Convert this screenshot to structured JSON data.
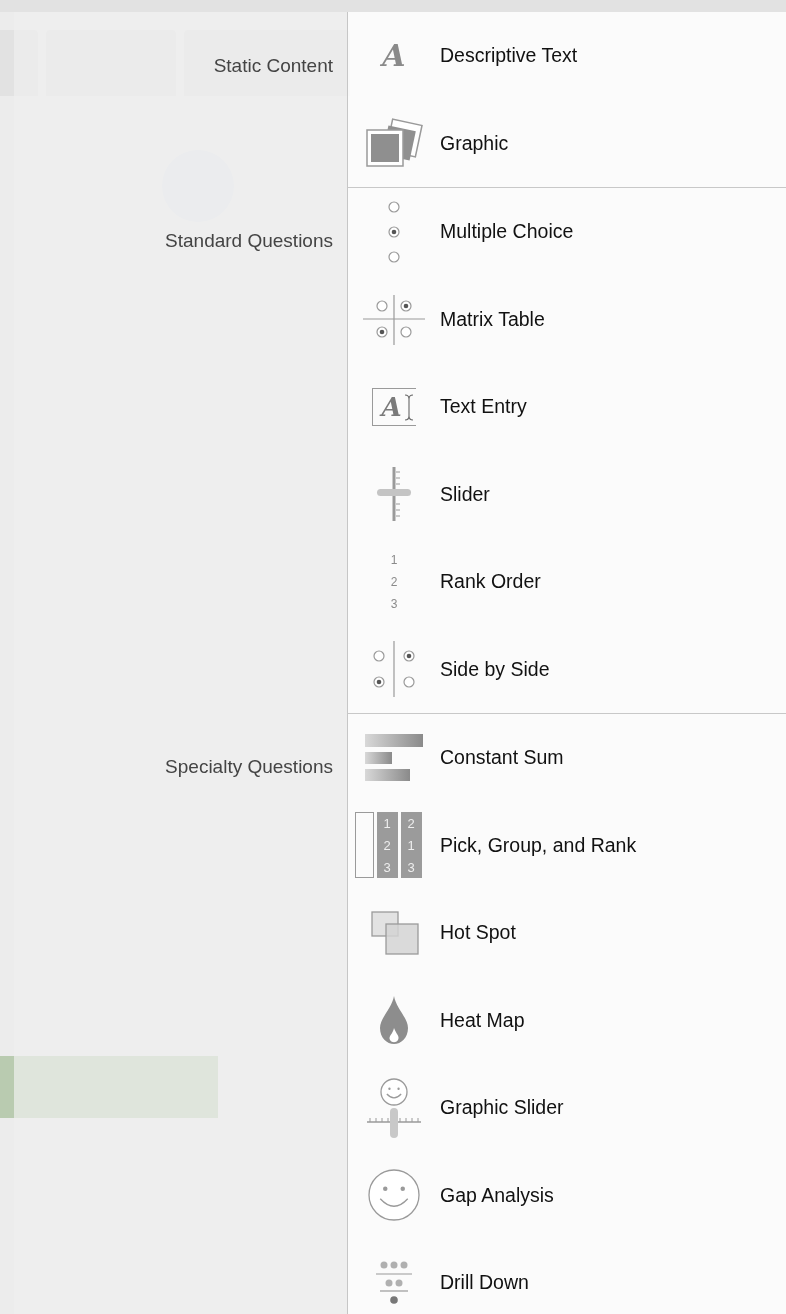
{
  "groups": [
    {
      "label": "Static Content",
      "items": [
        {
          "kind": "descriptive-text",
          "label": "Descriptive Text",
          "icon_glyph": "A"
        },
        {
          "kind": "graphic",
          "label": "Graphic"
        }
      ]
    },
    {
      "label": "Standard Questions",
      "items": [
        {
          "kind": "multiple-choice",
          "label": "Multiple Choice"
        },
        {
          "kind": "matrix",
          "label": "Matrix Table"
        },
        {
          "kind": "text-entry",
          "label": "Text Entry",
          "icon_glyph": "A"
        },
        {
          "kind": "slider",
          "label": "Slider"
        },
        {
          "kind": "rank-order",
          "label": "Rank Order",
          "icon_lines": [
            "1",
            "2",
            "3"
          ]
        },
        {
          "kind": "side-by-side",
          "label": "Side by Side"
        }
      ]
    },
    {
      "label": "Specialty Questions",
      "items": [
        {
          "kind": "constant-sum",
          "label": "Constant Sum"
        },
        {
          "kind": "pick-group-rank",
          "label": "Pick, Group, and Rank",
          "icon_columns": [
            [
              "1",
              "2",
              "3"
            ],
            [
              "2",
              "1",
              "3"
            ]
          ]
        },
        {
          "kind": "hot-spot",
          "label": "Hot Spot"
        },
        {
          "kind": "heat-map",
          "label": "Heat Map"
        },
        {
          "kind": "graphic-slider",
          "label": "Graphic Slider"
        },
        {
          "kind": "gap-analysis",
          "label": "Gap Analysis"
        },
        {
          "kind": "drill-down",
          "label": "Drill Down"
        }
      ]
    }
  ]
}
